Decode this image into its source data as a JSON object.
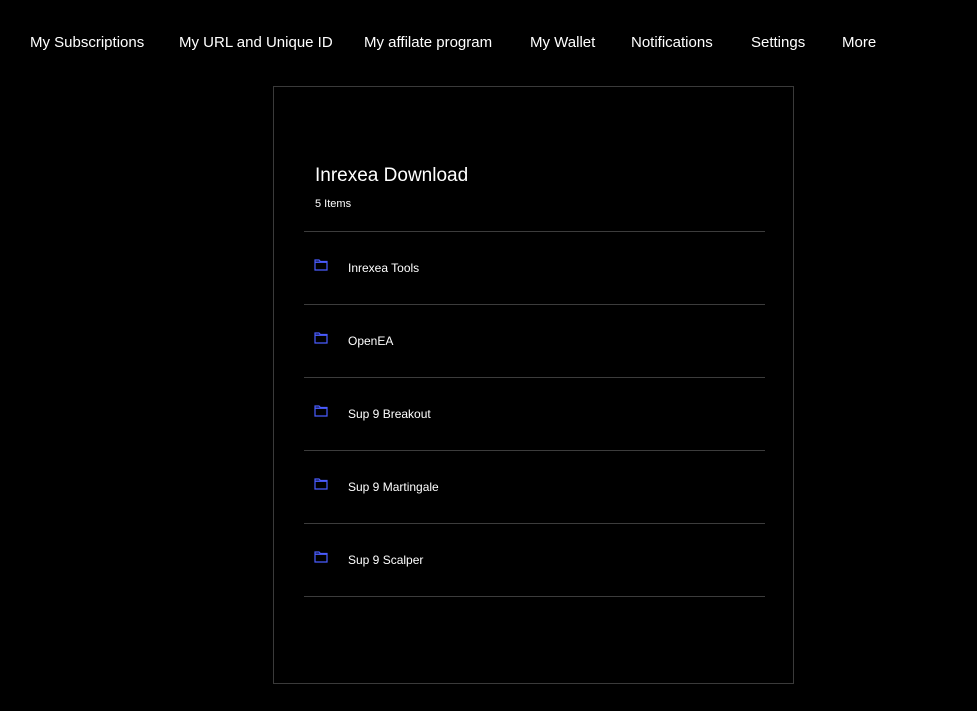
{
  "nav": {
    "items": [
      {
        "label": "My Subscriptions"
      },
      {
        "label": "My URL and Unique ID"
      },
      {
        "label": "My affilate program"
      },
      {
        "label": "My Wallet"
      },
      {
        "label": "Notifications"
      },
      {
        "label": "Settings"
      },
      {
        "label": "More"
      }
    ]
  },
  "folder": {
    "title": "Inrexea Download",
    "count": "5 Items",
    "items": [
      {
        "label": "Inrexea Tools",
        "icon": "folder-icon"
      },
      {
        "label": "OpenEA",
        "icon": "folder-icon"
      },
      {
        "label": "Sup 9 Breakout",
        "icon": "folder-icon"
      },
      {
        "label": "Sup 9 Martingale",
        "icon": "folder-icon"
      },
      {
        "label": "Sup 9 Scalper",
        "icon": "folder-icon"
      }
    ]
  },
  "colors": {
    "background": "#000000",
    "text": "#ffffff",
    "icon_accent": "#4a5cff",
    "border": "#3a3a3a"
  }
}
